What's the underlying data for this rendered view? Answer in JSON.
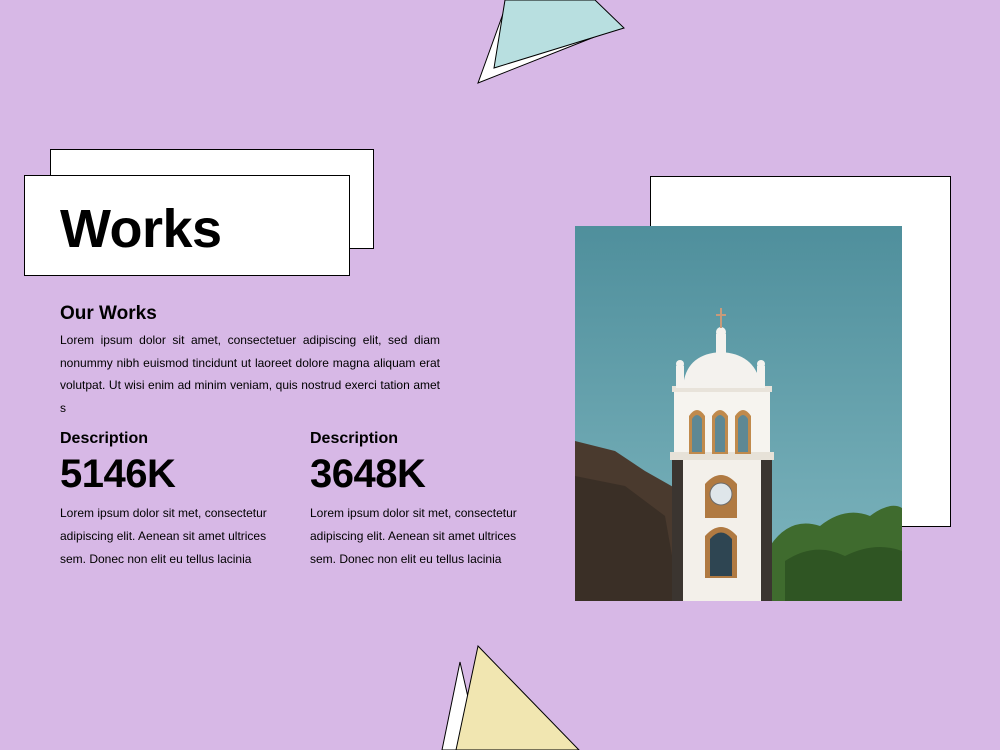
{
  "title": "Works",
  "section": {
    "heading": "Our Works",
    "body": "Lorem ipsum dolor sit amet, consectetuer adipiscing elit, sed diam nonummy nibh euismod tincidunt ut laoreet dolore magna aliquam erat volutpat. Ut wisi enim ad minim veniam, quis nostrud exerci tation amet s"
  },
  "stats": [
    {
      "label": "Description",
      "value": "5146K",
      "text": "Lorem ipsum dolor sit met, consectetur adipiscing elit. Aenean sit amet ultrices sem. Donec non elit eu tellus lacinia"
    },
    {
      "label": "Description",
      "value": "3648K",
      "text": "Lorem ipsum dolor sit met, consectetur adipiscing elit. Aenean sit amet ultrices sem. Donec non elit eu tellus lacinia"
    }
  ],
  "colors": {
    "background": "#d7b8e6",
    "triangle_top": "#b8dfe0",
    "triangle_bottom": "#f1e6b1",
    "sky": "#5f9fae",
    "tower": "#f3f0ea"
  },
  "images": {
    "photo": "church-bell-tower"
  }
}
